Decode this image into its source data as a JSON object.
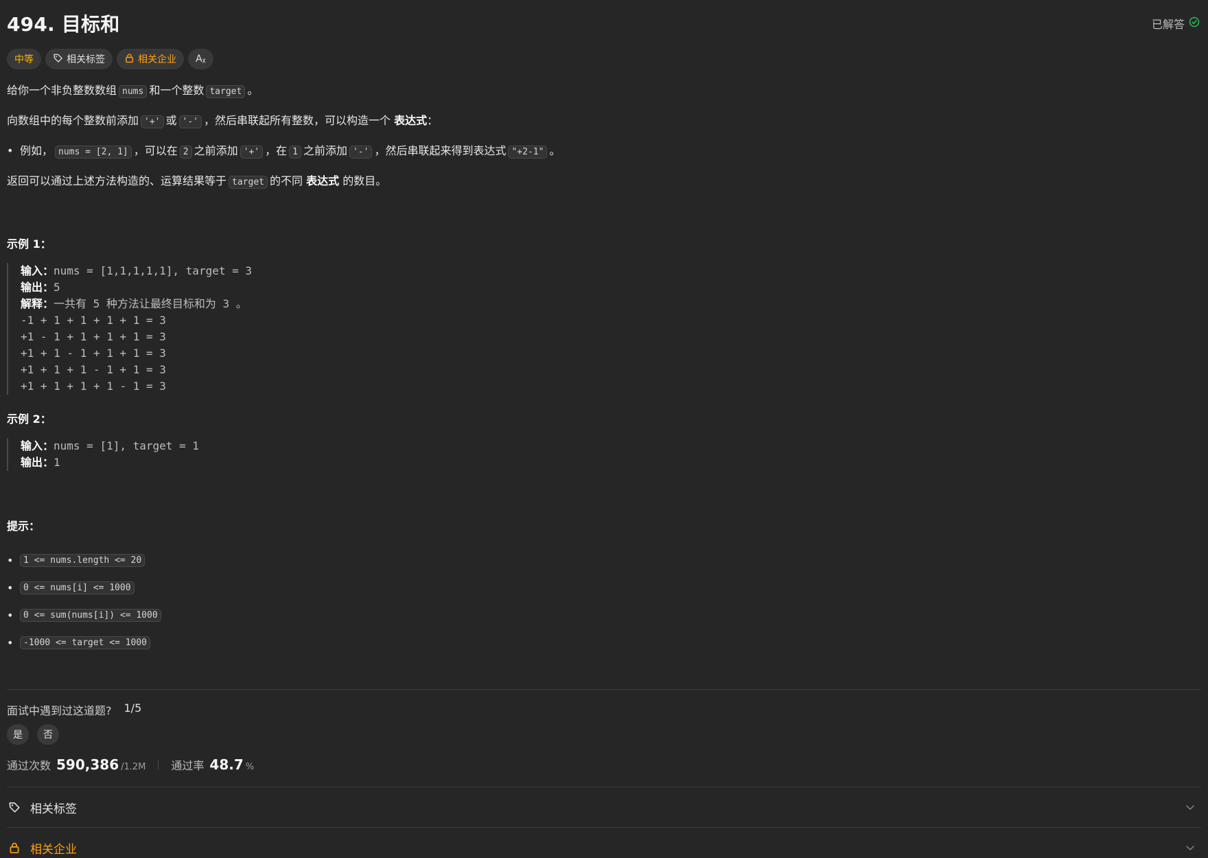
{
  "problem": {
    "title": "494. 目标和",
    "status_label": "已解答",
    "tags": {
      "difficulty": "中等",
      "related_tags": "相关标签",
      "related_companies": "相关企业",
      "translate": "Aᵪ"
    }
  },
  "description": {
    "p1": {
      "a": "给你一个非负整数数组",
      "code1": "nums",
      "b": "和一个整数",
      "code2": "target",
      "c": "。"
    },
    "p2": {
      "a": "向数组中的每个整数前添加",
      "code1": "'+'",
      "b": "或",
      "code2": "'-'",
      "c": "，然后串联起所有整数，可以构造一个",
      "bold": "表达式",
      "d": "："
    },
    "bullet": {
      "a": "例如，",
      "code1": "nums = [2, 1]",
      "b": "，可以在",
      "code2": "2",
      "c": "之前添加",
      "code3": "'+'",
      "d": "，在",
      "code4": "1",
      "e": "之前添加",
      "code5": "'-'",
      "f": "，然后串联起来得到表达式",
      "code6": "\"+2-1\"",
      "g": "。"
    },
    "p3": {
      "a": "返回可以通过上述方法构造的、运算结果等于",
      "code1": "target",
      "b": "的不同",
      "bold": "表达式",
      "c": "的数目。"
    }
  },
  "example1": {
    "heading": "示例 1：",
    "input_label": "输入：",
    "input": "nums = [1,1,1,1,1], target = 3",
    "output_label": "输出：",
    "output": "5",
    "explain_label": "解释：",
    "explain": "一共有 5 种方法让最终目标和为 3 。",
    "lines": [
      "-1 + 1 + 1 + 1 + 1 = 3",
      "+1 - 1 + 1 + 1 + 1 = 3",
      "+1 + 1 - 1 + 1 + 1 = 3",
      "+1 + 1 + 1 - 1 + 1 = 3",
      "+1 + 1 + 1 + 1 - 1 = 3"
    ]
  },
  "example2": {
    "heading": "示例 2：",
    "input_label": "输入：",
    "input": "nums = [1], target = 1",
    "output_label": "输出：",
    "output": "1"
  },
  "constraints": {
    "heading": "提示：",
    "items": [
      "1 <= nums.length <= 20",
      "0 <= nums[i] <= 1000",
      "0 <= sum(nums[i]) <= 1000",
      "-1000 <= target <= 1000"
    ]
  },
  "interview": {
    "question": "面试中遇到过这道题?",
    "count": "1/5",
    "yes": "是",
    "no": "否"
  },
  "stats": {
    "accepted_label": "通过次数",
    "accepted": "590,386",
    "submissions": "/1.2M",
    "rate_label": "通过率",
    "rate": "48.7",
    "rate_unit": "%"
  },
  "accordion": {
    "tags": "相关标签",
    "companies": "相关企业"
  },
  "colors": {
    "background": "#262626",
    "medium": "#ffb800",
    "accent": "#ffa116",
    "solved": "#2cbb5d"
  },
  "icons": [
    "check-circle-icon",
    "tag-icon",
    "lock-icon",
    "translate-icon",
    "chevron-down-icon"
  ]
}
